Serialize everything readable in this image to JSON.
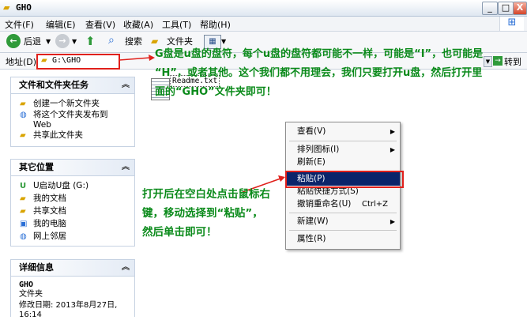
{
  "window": {
    "title": "GHO",
    "min": "_",
    "max": "□",
    "close": "X"
  },
  "menu": [
    "文件(F)",
    "编辑(E)",
    "查看(V)",
    "收藏(A)",
    "工具(T)",
    "帮助(H)"
  ],
  "toolbar": {
    "back": "后退",
    "search": "搜索",
    "folders": "文件夹"
  },
  "address": {
    "label": "地址(D)",
    "value": "G:\\GHO",
    "go": "转到"
  },
  "file": {
    "name": "Readme.txt"
  },
  "panels": {
    "tasks": {
      "title": "文件和文件夹任务",
      "items": [
        "创建一个新文件夹",
        "将这个文件夹发布到",
        "Web",
        "共享此文件夹"
      ]
    },
    "places": {
      "title": "其它位置",
      "items": [
        "U启动U盘 (G:)",
        "我的文档",
        "共享文档",
        "我的电脑",
        "网上邻居"
      ]
    },
    "details": {
      "title": "详细信息",
      "name": "GHO",
      "type": "文件夹",
      "modified_label": "修改日期: 2013年8月27日,",
      "modified_time": "16:14"
    }
  },
  "context_menu": {
    "view": "查看(V)",
    "arrange": "排列图标(I)",
    "refresh": "刷新(E)",
    "paste": "粘贴(P)",
    "paste_shortcut": "粘贴快捷方式(S)",
    "undo_rename": "撤销重命名(U)",
    "undo_shortcut": "Ctrl+Z",
    "new": "新建(W)",
    "properties": "属性(R)"
  },
  "annotations": {
    "top_1": "G盘是u盘的盘符，每个u盘的盘符都可能不一样，可能是“I”，也可能是",
    "top_2": "“H”，或者其他。这个我们都不用理会，我们只要打开u盘，然后打开里",
    "top_3": "面的“GHO”文件夹即可！",
    "left_1": "打开后在空白处点击鼠标右",
    "left_2": "键，移动选择到“粘贴”，",
    "left_3": "然后单击即可！"
  },
  "colors": {
    "annotation": "#0a8a1a",
    "highlight": "#e0201b",
    "selection": "#0a246a"
  }
}
